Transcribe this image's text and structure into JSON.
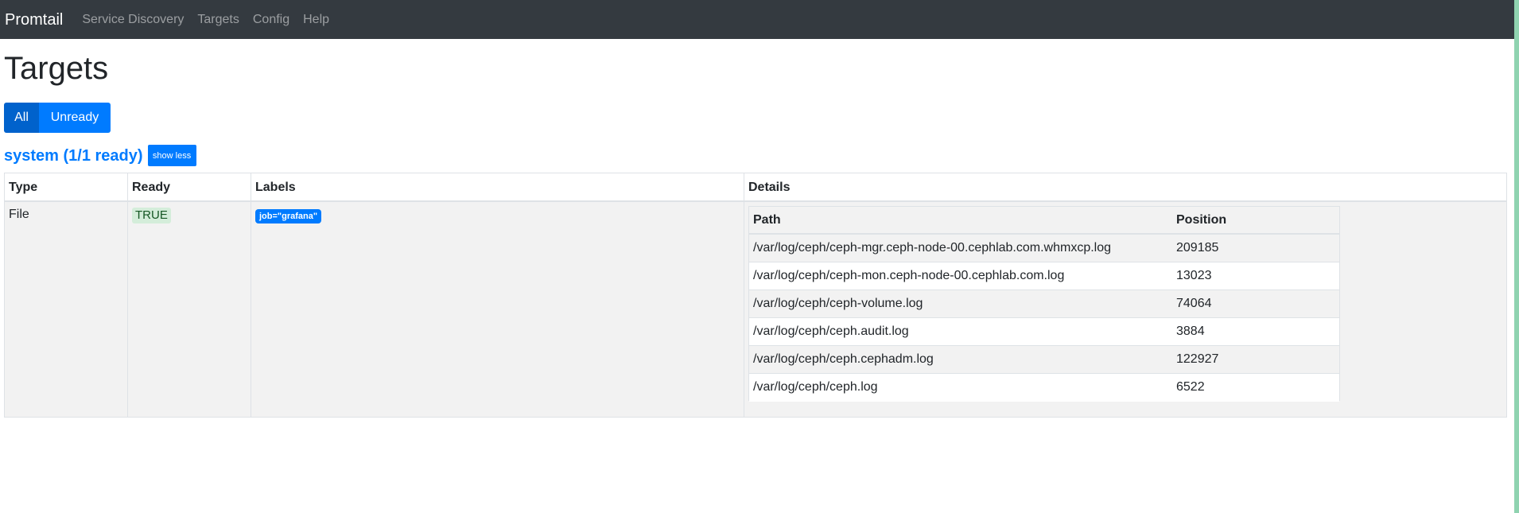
{
  "navbar": {
    "brand": "Promtail",
    "links": [
      "Service Discovery",
      "Targets",
      "Config",
      "Help"
    ]
  },
  "page": {
    "title": "Targets"
  },
  "filters": {
    "all": "All",
    "unready": "Unready",
    "active": "All"
  },
  "job": {
    "title": "system (1/1 ready)",
    "toggle_label": "show less"
  },
  "table": {
    "headers": [
      "Type",
      "Ready",
      "Labels",
      "Details"
    ],
    "rows": [
      {
        "type": "File",
        "ready": "TRUE",
        "labels": [
          "job=\"grafana\""
        ],
        "details": {
          "headers": [
            "Path",
            "Position"
          ],
          "rows": [
            {
              "path": "/var/log/ceph/ceph-mgr.ceph-node-00.cephlab.com.whmxcp.log",
              "position": "209185"
            },
            {
              "path": "/var/log/ceph/ceph-mon.ceph-node-00.cephlab.com.log",
              "position": "13023"
            },
            {
              "path": "/var/log/ceph/ceph-volume.log",
              "position": "74064"
            },
            {
              "path": "/var/log/ceph/ceph.audit.log",
              "position": "3884"
            },
            {
              "path": "/var/log/ceph/ceph.cephadm.log",
              "position": "122927"
            },
            {
              "path": "/var/log/ceph/ceph.log",
              "position": "6522"
            }
          ]
        }
      }
    ]
  },
  "colors": {
    "navbar": "#343a40",
    "primary": "#007bff",
    "primary_active": "#0062cc",
    "ready_bg": "#d4edda",
    "ready_text": "#155724"
  }
}
